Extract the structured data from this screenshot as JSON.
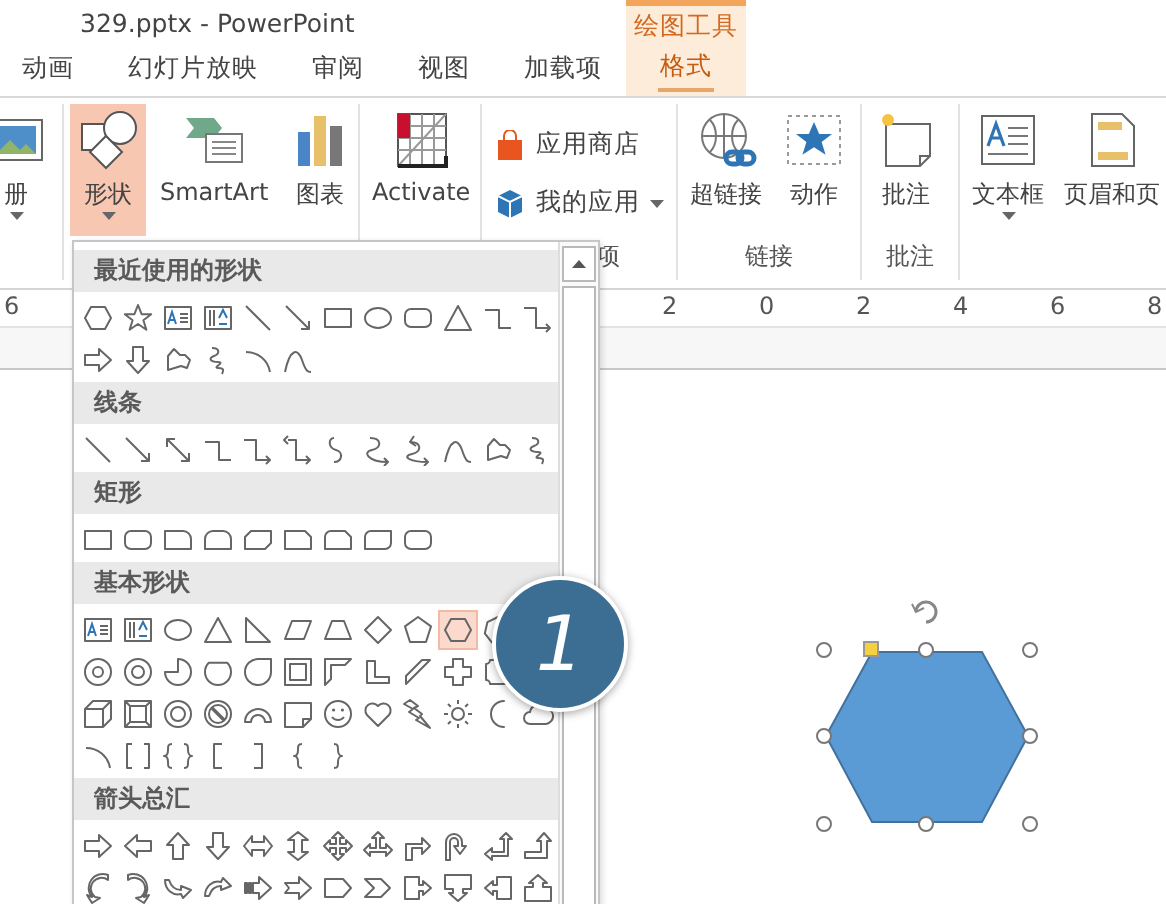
{
  "window": {
    "title": "329.pptx - PowerPoint",
    "context_label": "绘图工具"
  },
  "tabs": [
    {
      "label": "动画",
      "selected": false
    },
    {
      "label": "幻灯片放映",
      "selected": false
    },
    {
      "label": "审阅",
      "selected": false
    },
    {
      "label": "视图",
      "selected": false
    },
    {
      "label": "加载项",
      "selected": false
    }
  ],
  "context_tabs": [
    {
      "label": "格式",
      "selected": true
    }
  ],
  "ribbon": {
    "groups": [
      {
        "buttons": [
          {
            "label": "册",
            "kind": "large",
            "pressed": false,
            "has_menu": true
          }
        ]
      },
      {
        "buttons": [
          {
            "label": "形状",
            "kind": "large",
            "pressed": true,
            "has_menu": true
          },
          {
            "label": "SmartArt",
            "kind": "large",
            "pressed": false,
            "has_menu": false
          },
          {
            "label": "图表",
            "kind": "large",
            "pressed": false,
            "has_menu": false
          }
        ]
      },
      {
        "buttons": [
          {
            "label": "Activate",
            "kind": "large",
            "pressed": false,
            "has_menu": false
          }
        ]
      },
      {
        "label": "项",
        "buttons": [
          {
            "label": "应用商店",
            "kind": "small",
            "pressed": false,
            "has_menu": false
          },
          {
            "label": "我的应用",
            "kind": "small",
            "pressed": false,
            "has_menu": true
          }
        ]
      },
      {
        "label": "链接",
        "buttons": [
          {
            "label": "超链接",
            "kind": "large",
            "pressed": false,
            "has_menu": false
          },
          {
            "label": "动作",
            "kind": "large",
            "pressed": false,
            "has_menu": false
          }
        ]
      },
      {
        "label": "批注",
        "buttons": [
          {
            "label": "批注",
            "kind": "large",
            "pressed": false,
            "has_menu": false
          }
        ]
      },
      {
        "buttons": [
          {
            "label": "文本框",
            "kind": "large",
            "pressed": false,
            "has_menu": true
          },
          {
            "label": "页眉和页",
            "kind": "large",
            "pressed": false,
            "has_menu": false
          }
        ]
      }
    ]
  },
  "ruler": {
    "labels": [
      "6",
      "2",
      "0",
      "2",
      "4",
      "6",
      "8"
    ]
  },
  "shapes_gallery": {
    "sections": [
      {
        "title": "最近使用的形状",
        "rows": [
          [
            {
              "kind": "hexagon",
              "selected": false
            },
            {
              "kind": "star",
              "selected": false
            },
            {
              "kind": "textbox",
              "selected": false
            },
            {
              "kind": "vtextbox",
              "selected": false
            },
            {
              "kind": "line",
              "selected": false
            },
            {
              "kind": "arrowline",
              "selected": false
            },
            {
              "kind": "rect",
              "selected": false
            },
            {
              "kind": "ellipse",
              "selected": false
            },
            {
              "kind": "roundrect",
              "selected": false
            },
            {
              "kind": "triangle",
              "selected": false
            },
            {
              "kind": "elbow",
              "selected": false
            },
            {
              "kind": "elbowarrow",
              "selected": false
            }
          ],
          [
            {
              "kind": "rightarrow",
              "selected": false
            },
            {
              "kind": "downarrow",
              "selected": false
            },
            {
              "kind": "freeform",
              "selected": false
            },
            {
              "kind": "scribble",
              "selected": false
            },
            {
              "kind": "arc",
              "selected": false
            },
            {
              "kind": "curve",
              "selected": false
            }
          ]
        ]
      },
      {
        "title": "线条",
        "rows": [
          [
            {
              "kind": "line",
              "selected": false
            },
            {
              "kind": "arrowline",
              "selected": false
            },
            {
              "kind": "dblarrowline",
              "selected": false
            },
            {
              "kind": "elbow",
              "selected": false
            },
            {
              "kind": "elbowarrow",
              "selected": false
            },
            {
              "kind": "elbowdbl",
              "selected": false
            },
            {
              "kind": "curvedconn",
              "selected": false
            },
            {
              "kind": "curvedarrow",
              "selected": false
            },
            {
              "kind": "curveddbl",
              "selected": false
            },
            {
              "kind": "curve",
              "selected": false
            },
            {
              "kind": "freeform",
              "selected": false
            },
            {
              "kind": "scribble",
              "selected": false
            }
          ]
        ]
      },
      {
        "title": "矩形",
        "rows": [
          [
            {
              "kind": "rect",
              "selected": false
            },
            {
              "kind": "roundrect",
              "selected": false
            },
            {
              "kind": "round-one",
              "selected": false
            },
            {
              "kind": "round-top",
              "selected": false
            },
            {
              "kind": "snip-diag",
              "selected": false
            },
            {
              "kind": "snip-one",
              "selected": false
            },
            {
              "kind": "snip-round",
              "selected": false
            },
            {
              "kind": "round-diag",
              "selected": false
            },
            {
              "kind": "roundrect",
              "selected": false
            }
          ]
        ]
      },
      {
        "title": "基本形状",
        "rows": [
          [
            {
              "kind": "textbox",
              "selected": false
            },
            {
              "kind": "vtextbox",
              "selected": false
            },
            {
              "kind": "ellipse",
              "selected": false
            },
            {
              "kind": "triangle",
              "selected": false
            },
            {
              "kind": "right-triangle",
              "selected": false
            },
            {
              "kind": "parallelogram",
              "selected": false
            },
            {
              "kind": "trapezoid",
              "selected": false
            },
            {
              "kind": "diamond",
              "selected": false
            },
            {
              "kind": "pentagon",
              "selected": false
            },
            {
              "kind": "hexagon",
              "selected": true
            },
            {
              "kind": "heptagon",
              "selected": false
            }
          ],
          [
            {
              "kind": "decagon",
              "selected": false
            },
            {
              "kind": "dodecagon",
              "selected": false
            },
            {
              "kind": "pie",
              "selected": false
            },
            {
              "kind": "chord",
              "selected": false
            },
            {
              "kind": "teardrop",
              "selected": false
            },
            {
              "kind": "frame",
              "selected": false
            },
            {
              "kind": "half-frame",
              "selected": false
            },
            {
              "kind": "l-shape",
              "selected": false
            },
            {
              "kind": "diagonal-stripe",
              "selected": false
            },
            {
              "kind": "cross",
              "selected": false
            },
            {
              "kind": "plaque",
              "selected": false
            }
          ],
          [
            {
              "kind": "cube",
              "selected": false
            },
            {
              "kind": "bevel",
              "selected": false
            },
            {
              "kind": "donut",
              "selected": false
            },
            {
              "kind": "no-symbol",
              "selected": false
            },
            {
              "kind": "block-arc",
              "selected": false
            },
            {
              "kind": "folded-corner",
              "selected": false
            },
            {
              "kind": "smiley",
              "selected": false
            },
            {
              "kind": "heart",
              "selected": false
            },
            {
              "kind": "lightning",
              "selected": false
            },
            {
              "kind": "sun",
              "selected": false
            },
            {
              "kind": "moon",
              "selected": false
            },
            {
              "kind": "cloud",
              "selected": false
            }
          ],
          [
            {
              "kind": "arc",
              "selected": false
            },
            {
              "kind": "bracket-pair",
              "selected": false
            },
            {
              "kind": "brace-pair",
              "selected": false
            },
            {
              "kind": "left-bracket",
              "selected": false
            },
            {
              "kind": "right-bracket",
              "selected": false
            },
            {
              "kind": "left-brace",
              "selected": false
            },
            {
              "kind": "right-brace",
              "selected": false
            }
          ]
        ]
      },
      {
        "title": "箭头总汇",
        "rows": [
          [
            {
              "kind": "rightarrow",
              "selected": false
            },
            {
              "kind": "leftarrow",
              "selected": false
            },
            {
              "kind": "uparrow",
              "selected": false
            },
            {
              "kind": "downarrow",
              "selected": false
            },
            {
              "kind": "leftright",
              "selected": false
            },
            {
              "kind": "updown",
              "selected": false
            },
            {
              "kind": "quad",
              "selected": false
            },
            {
              "kind": "leftrightup",
              "selected": false
            },
            {
              "kind": "bent",
              "selected": false
            },
            {
              "kind": "uturn",
              "selected": false
            },
            {
              "kind": "leftup",
              "selected": false
            },
            {
              "kind": "bentup",
              "selected": false
            }
          ],
          [
            {
              "kind": "curved-right",
              "selected": false
            },
            {
              "kind": "curved-left",
              "selected": false
            },
            {
              "kind": "curved-up",
              "selected": false
            },
            {
              "kind": "curved-down",
              "selected": false
            },
            {
              "kind": "striped-right",
              "selected": false
            },
            {
              "kind": "notched-right",
              "selected": false
            },
            {
              "kind": "pentagon-arrow",
              "selected": false
            },
            {
              "kind": "chevron",
              "selected": false
            },
            {
              "kind": "right-callout",
              "selected": false
            },
            {
              "kind": "down-callout",
              "selected": false
            },
            {
              "kind": "left-callout",
              "selected": false
            },
            {
              "kind": "up-callout",
              "selected": false
            }
          ]
        ]
      }
    ]
  },
  "slide": {
    "shape": {
      "kind": "hexagon",
      "color": "#5b9bd5",
      "selected": true
    }
  },
  "callout": {
    "text": "1"
  }
}
